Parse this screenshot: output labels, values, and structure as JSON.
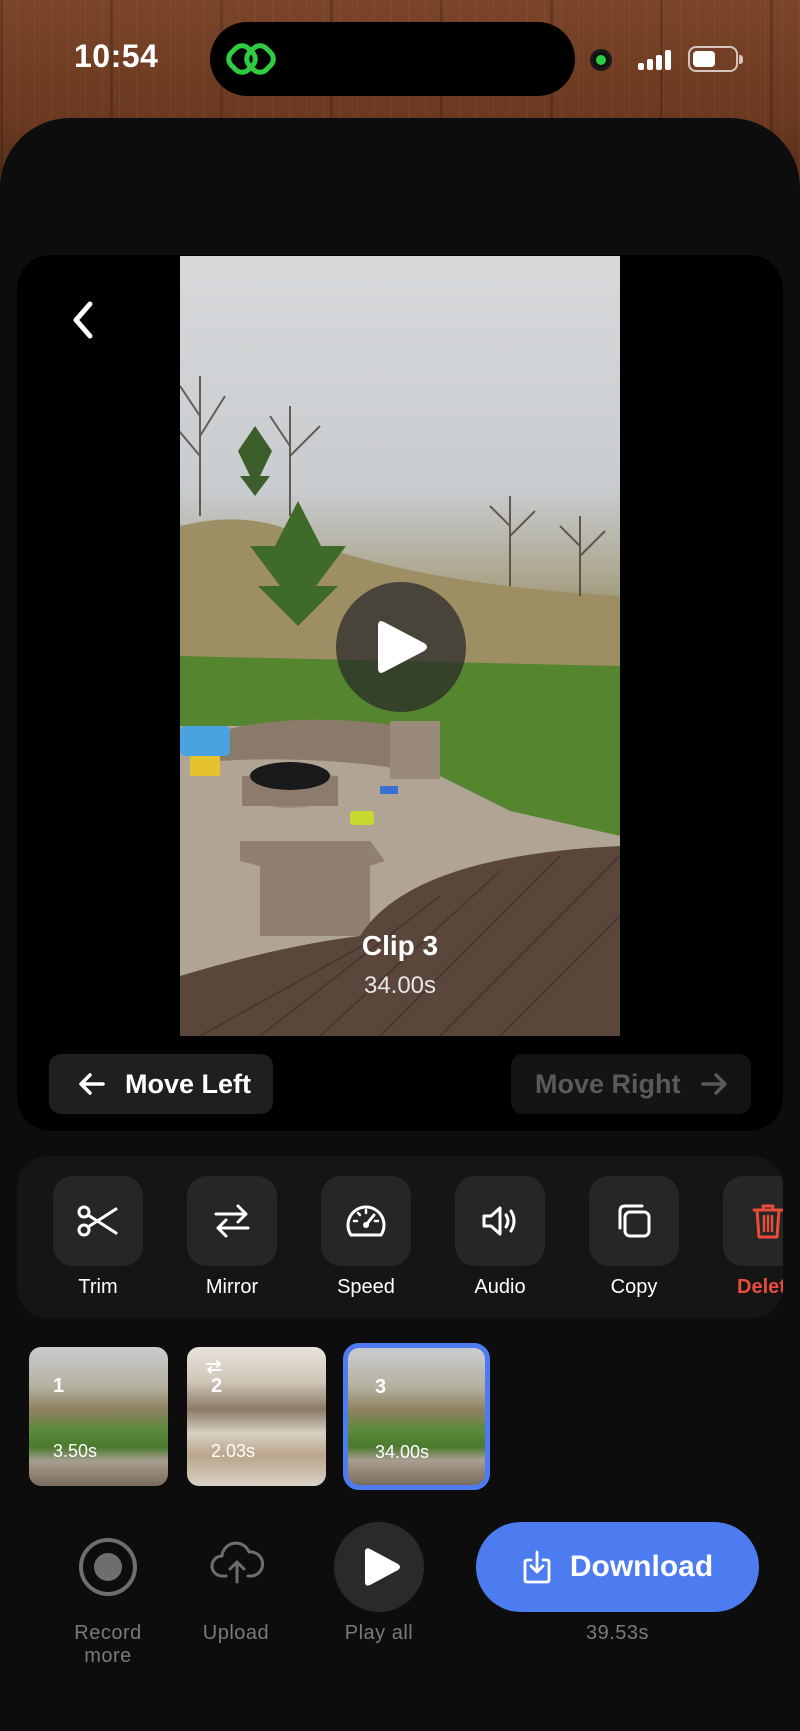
{
  "status_bar": {
    "time": "10:54"
  },
  "player": {
    "clip_title": "Clip 3",
    "clip_duration": "34.00s",
    "move_left_label": "Move Left",
    "move_right_label": "Move Right"
  },
  "tools": [
    {
      "label": "Trim",
      "icon": "scissors-icon"
    },
    {
      "label": "Mirror",
      "icon": "swap-arrows-icon"
    },
    {
      "label": "Speed",
      "icon": "speedometer-icon"
    },
    {
      "label": "Audio",
      "icon": "speaker-icon"
    },
    {
      "label": "Copy",
      "icon": "copy-icon"
    },
    {
      "label": "Delete",
      "icon": "trash-icon"
    }
  ],
  "clips": [
    {
      "number": "1",
      "duration": "3.50s",
      "selected": false
    },
    {
      "number": "2",
      "duration": "2.03s",
      "selected": false
    },
    {
      "number": "3",
      "duration": "34.00s",
      "selected": true
    }
  ],
  "bottom_bar": {
    "record_label": "Record more",
    "upload_label": "Upload",
    "play_all_label": "Play all",
    "download_label": "Download",
    "total_duration": "39.53s"
  },
  "colors": {
    "accent": "#4c7cf0",
    "danger": "#e74c3c",
    "app_logo": "#2ecc40"
  }
}
